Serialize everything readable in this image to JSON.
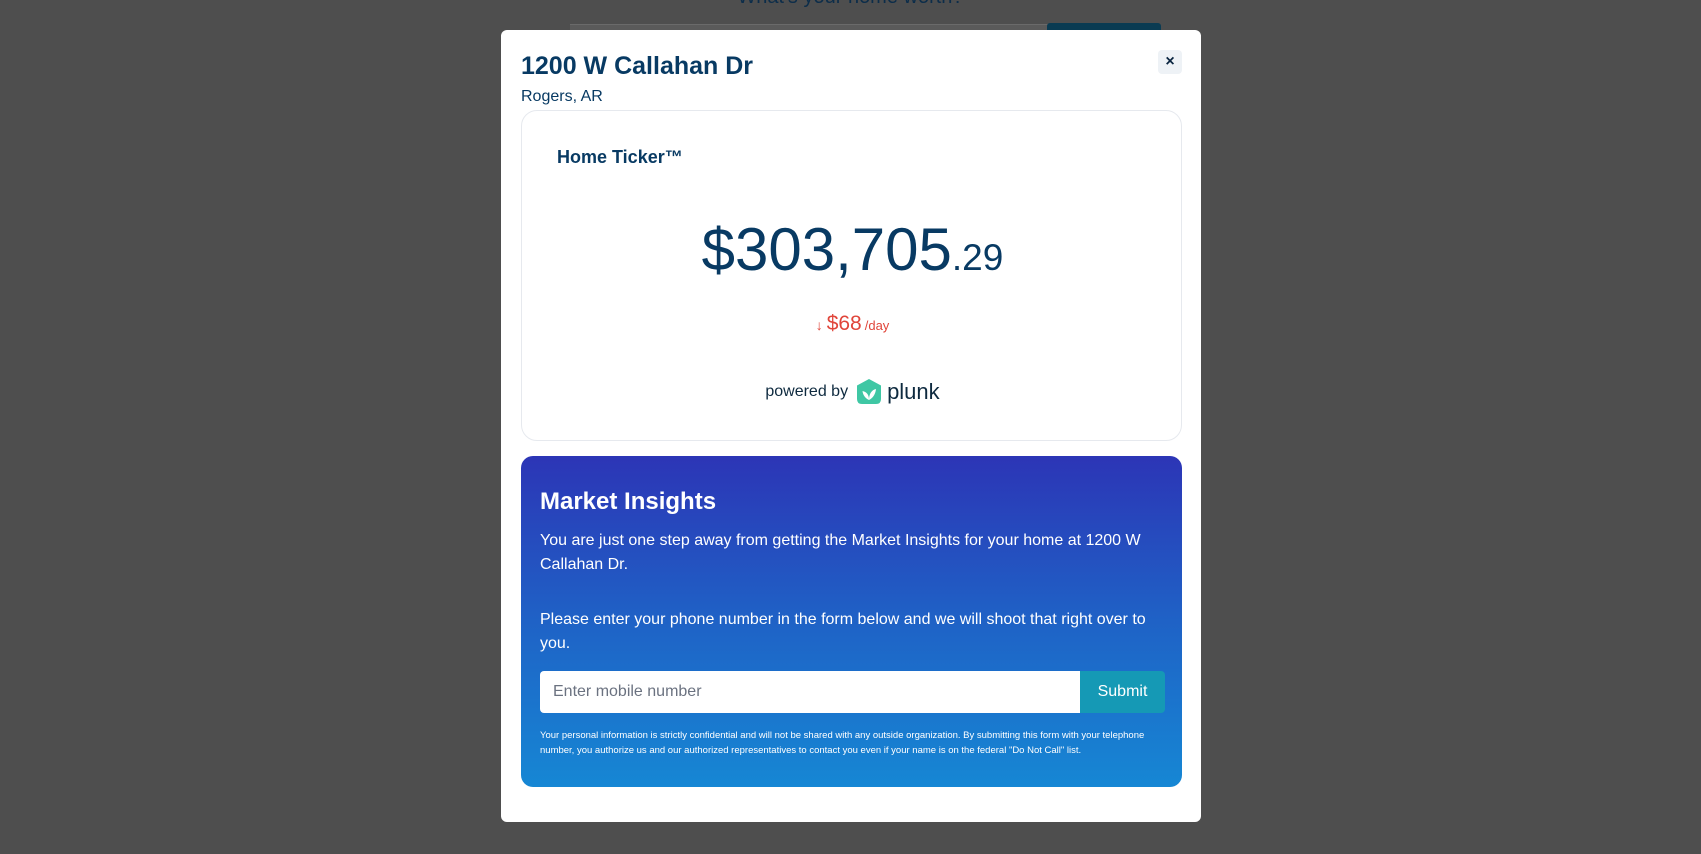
{
  "backdrop": {
    "heading": "What's your home worth?"
  },
  "modal": {
    "title": "1200 W Callahan Dr",
    "subtitle": "Rogers, AR",
    "close_label": "×"
  },
  "ticker": {
    "title": "Home Ticker™",
    "value_main": "$303,705",
    "value_cents": ".29",
    "change_arrow": "↓",
    "change_amount": "$68",
    "change_unit": "/day",
    "powered_by": "powered by",
    "brand_name": "plunk"
  },
  "insights": {
    "title": "Market Insights",
    "paragraph_1": "You are just one step away from getting the Market Insights for your home at 1200 W Callahan Dr.",
    "paragraph_2": "Please enter your phone number in the form below and we will shoot that right over to you.",
    "phone_placeholder": "Enter mobile number",
    "phone_value": "",
    "submit_label": "Submit",
    "disclaimer": "Your personal information is strictly confidential and will not be shared with any outside organization. By submitting this form with your telephone number, you authorize us and our authorized representatives to contact you even if your name is on the federal \"Do Not Call\" list."
  },
  "colors": {
    "overlay": "#4e4e4e",
    "navy": "#083a63",
    "decrease": "#e0453a",
    "gradient_top": "#2c35b6",
    "gradient_bottom": "#1687d4",
    "submit": "#1599b5",
    "brand_teal": "#3fc7a4"
  },
  "icons": {
    "close": "close-icon",
    "arrow": "arrow-down-icon",
    "brand": "plunk-logo-icon"
  }
}
